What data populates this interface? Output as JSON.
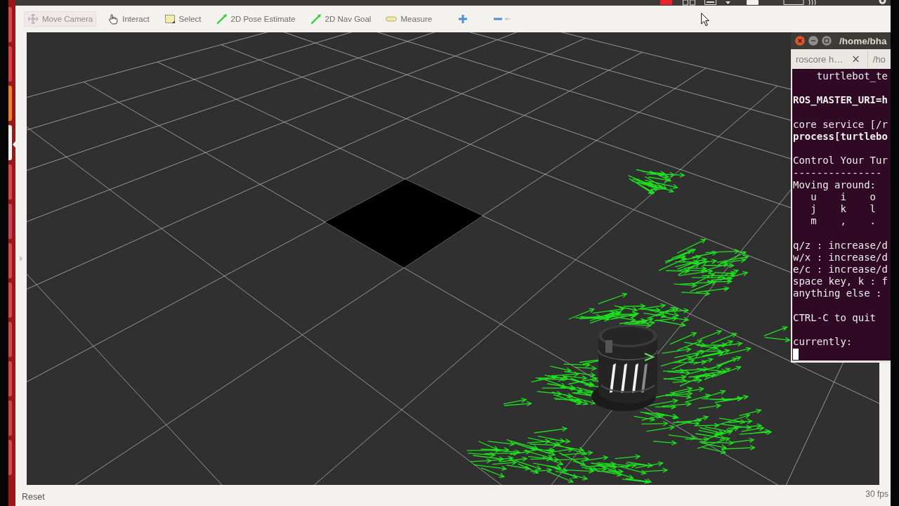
{
  "toolbar": {
    "tools": [
      {
        "label": "Move Camera",
        "kind": "move_camera",
        "selected": true
      },
      {
        "label": "Interact",
        "kind": "interact",
        "selected": false
      },
      {
        "label": "Select",
        "kind": "select",
        "selected": false
      },
      {
        "label": "2D Pose Estimate",
        "kind": "pose_estimate",
        "selected": false
      },
      {
        "label": "2D Nav Goal",
        "kind": "nav_goal",
        "selected": false
      },
      {
        "label": "Measure",
        "kind": "measure",
        "selected": false
      }
    ]
  },
  "terminal": {
    "title": "/home/bha",
    "tabs": [
      {
        "label": "roscore h…",
        "close": "×"
      },
      {
        "label": "/ho"
      }
    ],
    "blocks": [
      [
        {
          "text": "    turtlebot_te",
          "bold": false
        }
      ],
      [
        {
          "text": "ROS_MASTER_URI=h",
          "bold": true
        }
      ],
      [
        {
          "text": "core service [/r",
          "bold": false
        },
        {
          "text": "process[turtlebo",
          "bold": true
        }
      ],
      [
        {
          "text": "Control Your Tur",
          "bold": false
        },
        {
          "text": "---------------",
          "bold": false
        },
        {
          "text": "Moving around:",
          "bold": false
        },
        {
          "text": "   u    i    o",
          "bold": false
        },
        {
          "text": "   j    k    l",
          "bold": false
        },
        {
          "text": "   m    ,    .",
          "bold": false
        }
      ],
      [
        {
          "text": "q/z : increase/d",
          "bold": false
        },
        {
          "text": "w/x : increase/d",
          "bold": false
        },
        {
          "text": "e/c : increase/d",
          "bold": false
        },
        {
          "text": "space key, k : f",
          "bold": false
        },
        {
          "text": "anything else :",
          "bold": false
        }
      ],
      [
        {
          "text": "CTRL-C to quit",
          "bold": false
        }
      ],
      [
        {
          "text": "currently:",
          "bold": false
        }
      ]
    ],
    "cursor": true
  },
  "status_bar": {
    "reset": "Reset",
    "fps": "30 fps"
  }
}
